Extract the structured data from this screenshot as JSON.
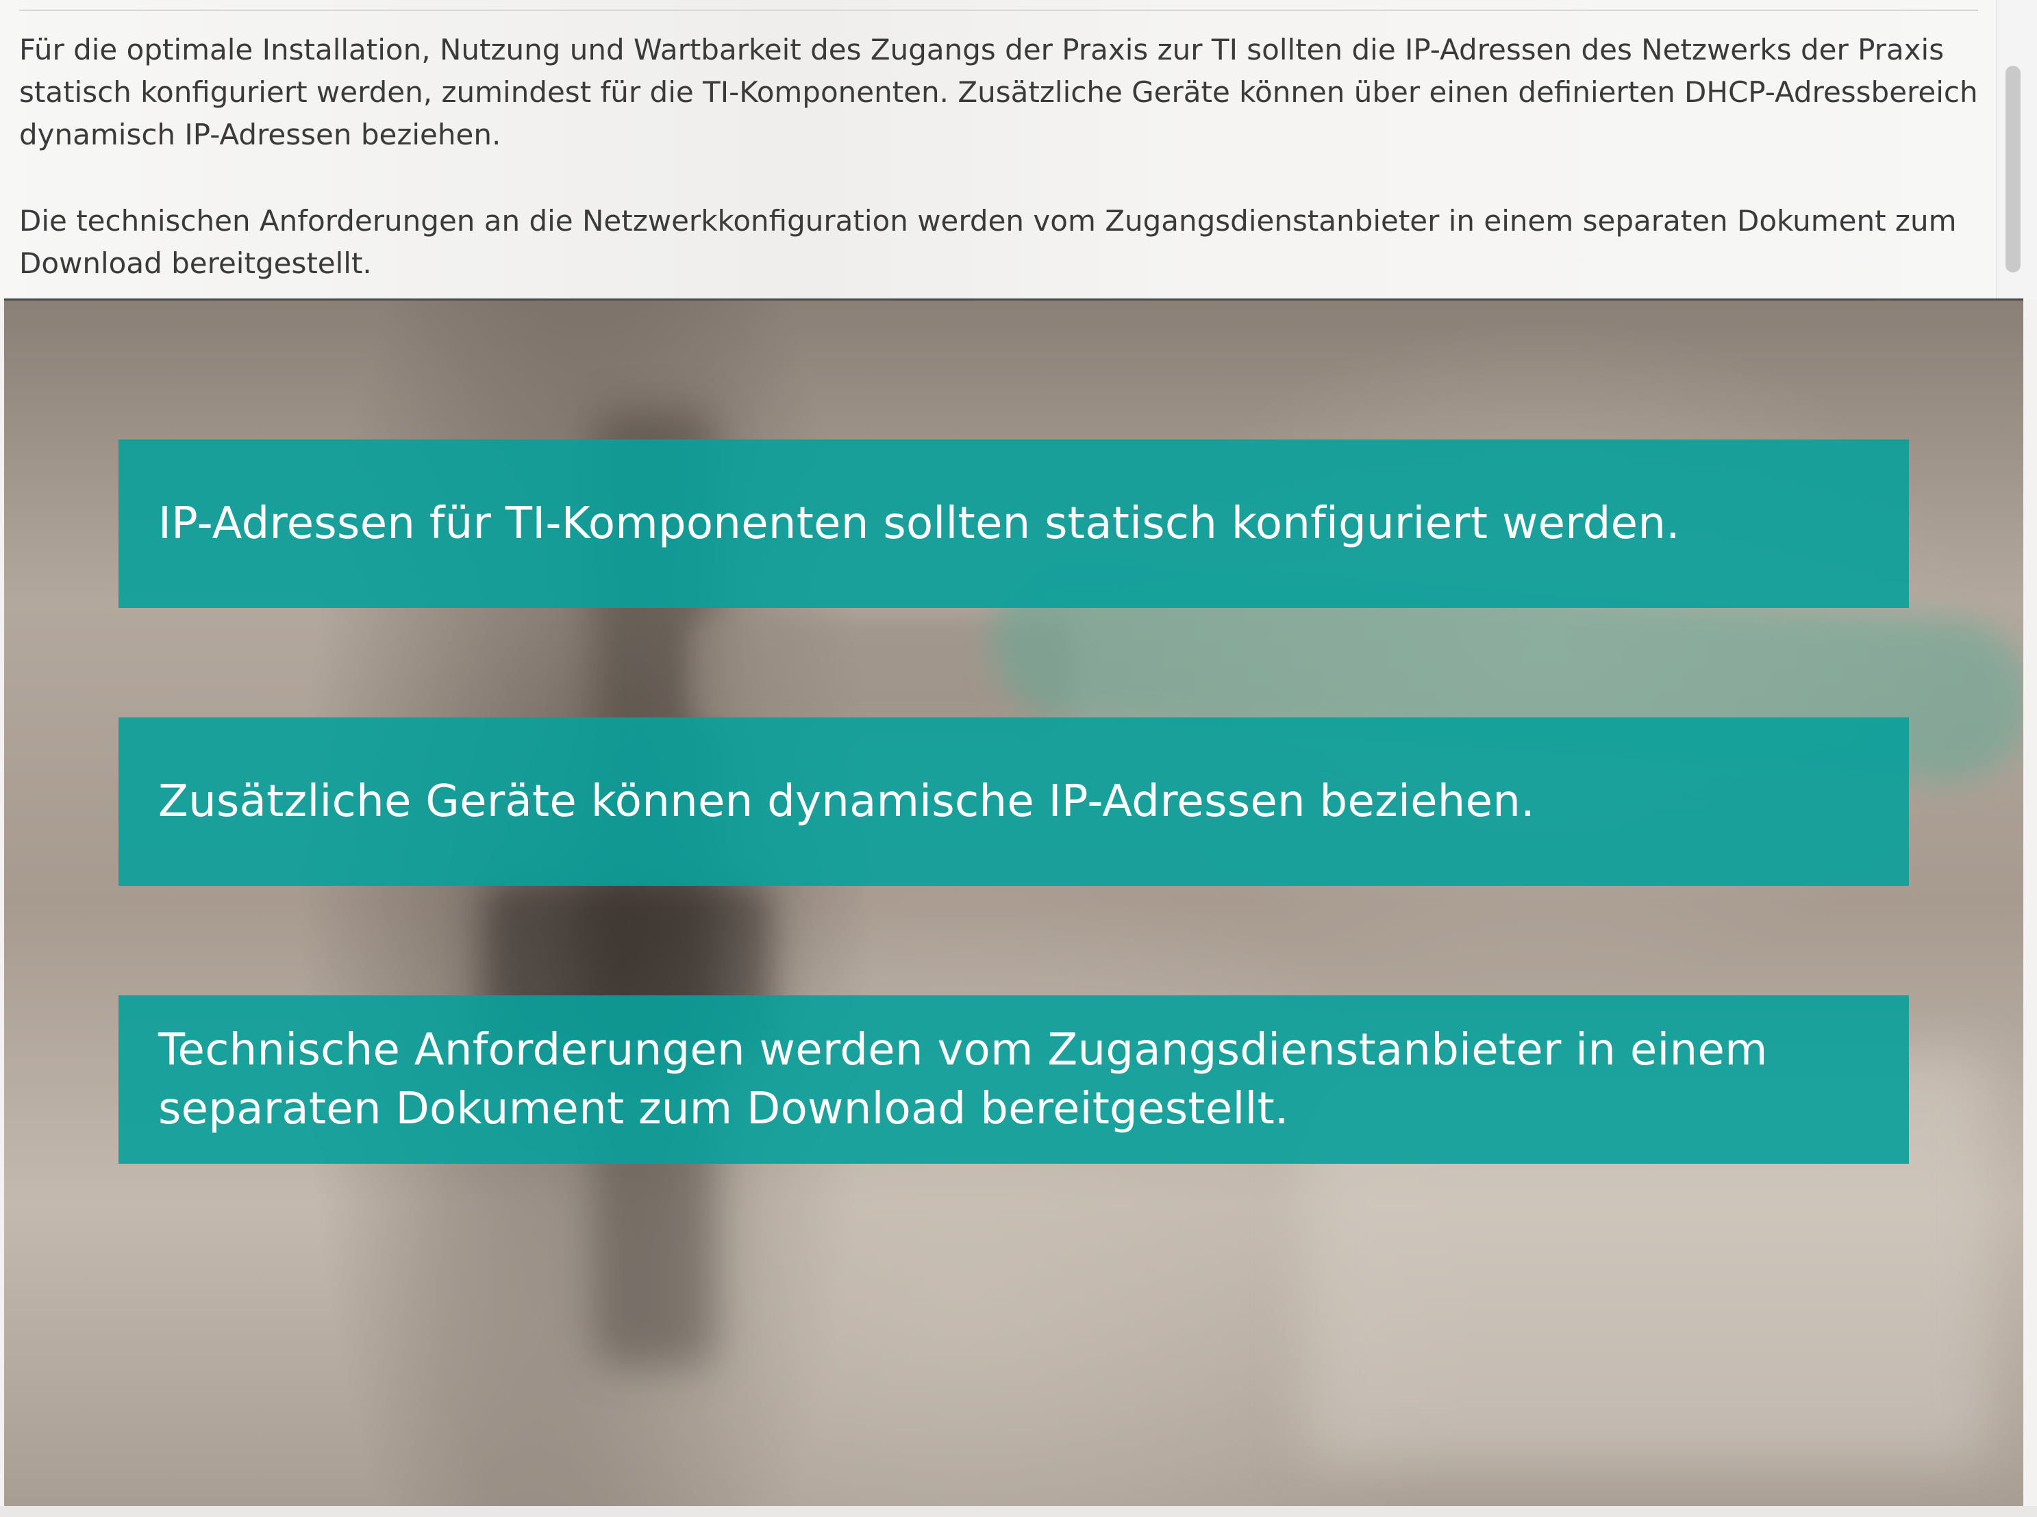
{
  "intro": {
    "paragraph_1": "Für die optimale Installation, Nutzung und Wartbarkeit des Zugangs der Praxis zur TI sollten die IP-Adressen des Netzwerks der Praxis statisch konfiguriert werden, zumindest für die TI-Komponenten. Zusätzliche Geräte können über einen definierten DHCP-Adressbereich dynamisch IP-Adressen beziehen.",
    "paragraph_2": "Die technischen Anforderungen an die Netzwerkkonfiguration werden vom Zugangsdienstanbieter in einem separaten Dokument zum Download bereitgestellt."
  },
  "slide": {
    "cards": [
      {
        "text": "IP-Adressen für TI-Komponenten sollten statisch konfiguriert werden."
      },
      {
        "text": "Zusätzliche Geräte können dynamische IP-Adressen beziehen."
      },
      {
        "text": "Technische Anforderungen werden vom Zugangsdienstanbieter in einem separaten Dokument zum Download bereitgestellt."
      }
    ]
  },
  "colors": {
    "card_background": "#0aa09b",
    "card_text": "#ffffff",
    "body_text": "#3a3a3a"
  }
}
